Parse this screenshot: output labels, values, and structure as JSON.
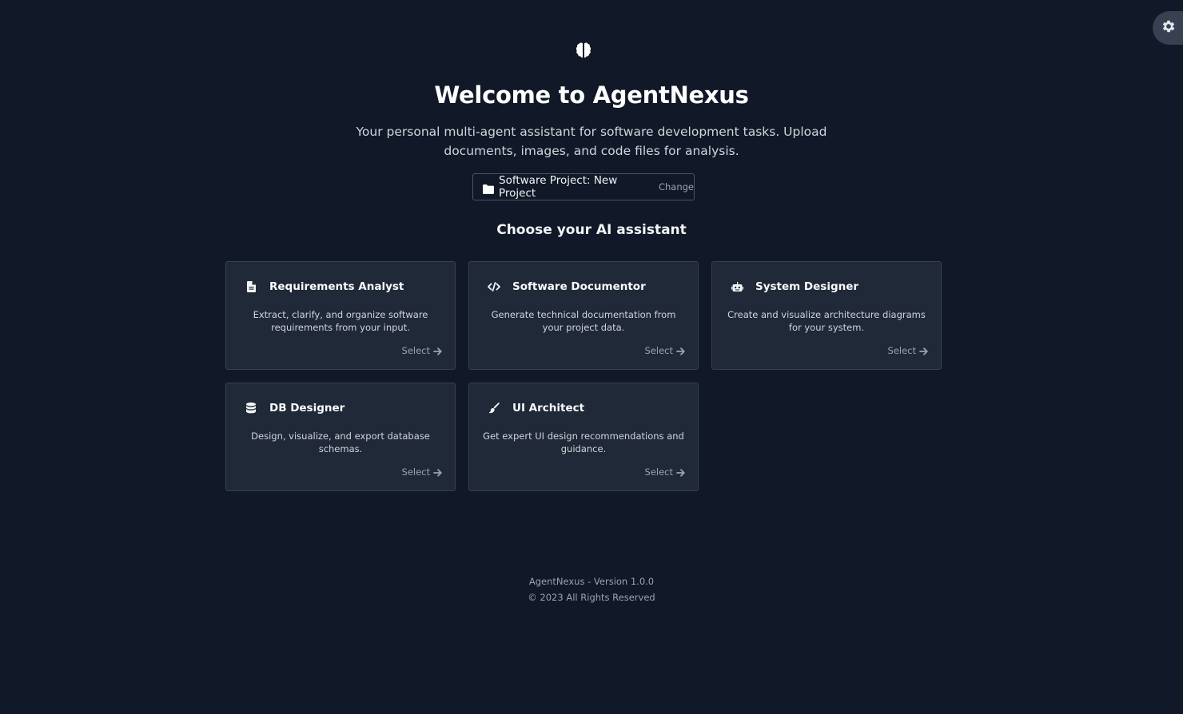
{
  "settings": {
    "icon": "gear-icon"
  },
  "hero": {
    "icon": "brain-icon",
    "title": "Welcome to AgentNexus",
    "subtitle": "Your personal multi-agent assistant for software development tasks. Upload documents, images, and code files for analysis."
  },
  "project": {
    "icon": "folder-icon",
    "label": "Software Project: New Project",
    "change_label": "Change"
  },
  "choose_heading": "Choose your AI assistant",
  "agents": [
    {
      "icon": "document-icon",
      "name": "Requirements Analyst",
      "description": "Extract, clarify, and organize software requirements from your input.",
      "select_label": "Select"
    },
    {
      "icon": "code-icon",
      "name": "Software Documentor",
      "description": "Generate technical documentation from your project data.",
      "select_label": "Select"
    },
    {
      "icon": "robot-icon",
      "name": "System Designer",
      "description": "Create and visualize architecture diagrams for your system.",
      "select_label": "Select"
    },
    {
      "icon": "database-icon",
      "name": "DB Designer",
      "description": "Design, visualize, and export database schemas.",
      "select_label": "Select"
    },
    {
      "icon": "paintbrush-icon",
      "name": "UI Architect",
      "description": "Get expert UI design recommendations and guidance.",
      "select_label": "Select"
    }
  ],
  "footer": {
    "version": "AgentNexus - Version 1.0.0",
    "copyright": "© 2023 All Rights Reserved"
  }
}
